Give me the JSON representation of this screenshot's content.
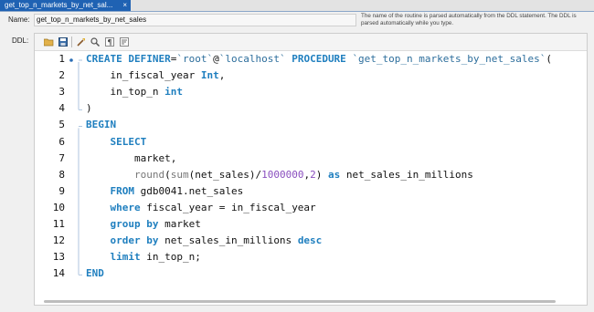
{
  "tab": {
    "title": "get_top_n_markets_by_net_sal...",
    "close": "×"
  },
  "name_label": "Name:",
  "name_value": "get_top_n_markets_by_net_sales",
  "help_text": "The name of the routine is parsed automatically from the DDL statement. The DDL is parsed automatically while you type.",
  "ddl_label": "DDL:",
  "toolbar": [
    "open-icon",
    "save-icon",
    "beautify-icon",
    "find-icon",
    "invisible-chars-icon",
    "wrap-icon"
  ],
  "lines": [
    {
      "n": "1",
      "segs": [
        [
          "kw",
          "CREATE DEFINER"
        ],
        [
          "t",
          "="
        ],
        [
          "str",
          "`root`"
        ],
        [
          "t",
          "@"
        ],
        [
          "str",
          "`localhost`"
        ],
        [
          "t",
          " "
        ],
        [
          "kw",
          "PROCEDURE"
        ],
        [
          "t",
          " "
        ],
        [
          "str",
          "`get_top_n_markets_by_net_sales`"
        ],
        [
          "t",
          "("
        ]
      ]
    },
    {
      "n": "2",
      "segs": [
        [
          "t",
          "    in_fiscal_year "
        ],
        [
          "kw",
          "Int"
        ],
        [
          "t",
          ","
        ]
      ]
    },
    {
      "n": "3",
      "segs": [
        [
          "t",
          "    in_top_n "
        ],
        [
          "kw",
          "int"
        ]
      ]
    },
    {
      "n": "4",
      "segs": [
        [
          "t",
          ")"
        ]
      ]
    },
    {
      "n": "5",
      "segs": [
        [
          "kw",
          "BEGIN"
        ]
      ]
    },
    {
      "n": "6",
      "segs": [
        [
          "t",
          "    "
        ],
        [
          "kw",
          "SELECT"
        ]
      ]
    },
    {
      "n": "7",
      "segs": [
        [
          "t",
          "        market,"
        ]
      ]
    },
    {
      "n": "8",
      "segs": [
        [
          "t",
          "        "
        ],
        [
          "fn",
          "round"
        ],
        [
          "t",
          "("
        ],
        [
          "fn",
          "sum"
        ],
        [
          "t",
          "(net_sales)/"
        ],
        [
          "num",
          "1000000"
        ],
        [
          "t",
          ","
        ],
        [
          "num",
          "2"
        ],
        [
          "t",
          ") "
        ],
        [
          "kw",
          "as"
        ],
        [
          "t",
          " net_sales_in_millions"
        ]
      ]
    },
    {
      "n": "9",
      "segs": [
        [
          "t",
          "    "
        ],
        [
          "kw",
          "FROM"
        ],
        [
          "t",
          " gdb0041.net_sales"
        ]
      ]
    },
    {
      "n": "10",
      "segs": [
        [
          "t",
          "    "
        ],
        [
          "kw",
          "where"
        ],
        [
          "t",
          " fiscal_year = in_fiscal_year"
        ]
      ]
    },
    {
      "n": "11",
      "segs": [
        [
          "t",
          "    "
        ],
        [
          "kw",
          "group by"
        ],
        [
          "t",
          " market"
        ]
      ]
    },
    {
      "n": "12",
      "segs": [
        [
          "t",
          "    "
        ],
        [
          "kw",
          "order by"
        ],
        [
          "t",
          " net_sales_in_millions "
        ],
        [
          "kw",
          "desc"
        ]
      ]
    },
    {
      "n": "13",
      "segs": [
        [
          "t",
          "    "
        ],
        [
          "kw",
          "limit"
        ],
        [
          "t",
          " in_top_n;"
        ]
      ]
    },
    {
      "n": "14",
      "segs": [
        [
          "kw",
          "END"
        ]
      ]
    }
  ]
}
